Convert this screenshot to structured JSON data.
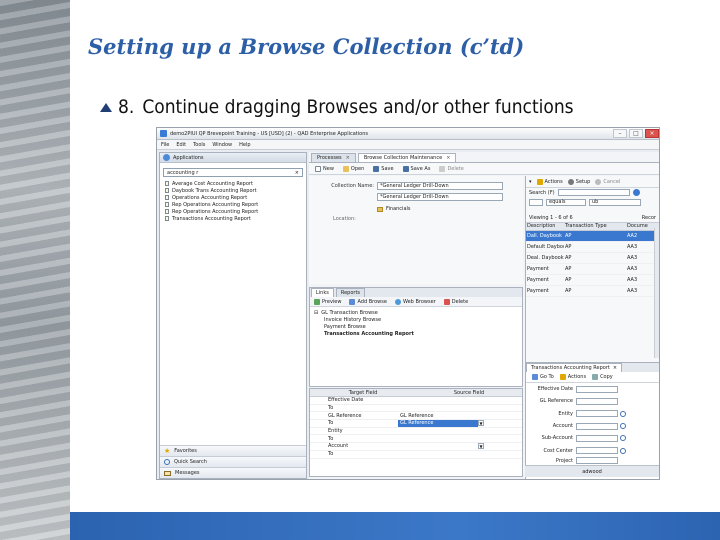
{
  "slide": {
    "title": "Setting up a Browse Collection (c’td)",
    "bullet_number": "8.",
    "bullet_text": "Continue dragging Browses and/or other functions"
  },
  "window": {
    "title": "demo2PIUI QP Brevepoint Training - US [USD] (2) - QAD Enterprise Applications",
    "menu": [
      "File",
      "Edit",
      "Tools",
      "Window",
      "Help"
    ]
  },
  "nav": {
    "header": "Applications",
    "search_value": "accounting r",
    "items": [
      "Average Cost Accounting Report",
      "Daybook Trans Accounting Report",
      "Operations Accounting Report",
      "Rep Operations Accounting Report",
      "Rep Operations Accounting Report",
      "Transactions Accounting Report"
    ],
    "bottom": [
      "Favorites",
      "Quick Search",
      "Messages"
    ]
  },
  "main": {
    "tabs": [
      {
        "label": "Processes",
        "active": false
      },
      {
        "label": "Browse Collection Maintenance",
        "active": true
      }
    ],
    "toolbar": [
      "New",
      "Open",
      "Save",
      "Save As",
      "Delete"
    ],
    "form": {
      "collection_label": "Collection Name:",
      "collection_value": "*General Ledger Drill-Down",
      "description_value": "*General Ledger Drill-Down",
      "location_label": "Location:",
      "location_value": "Financials"
    },
    "links_tabs": [
      {
        "label": "Links",
        "active": true
      },
      {
        "label": "Reports",
        "active": false
      }
    ],
    "links_toolbar": [
      "Preview",
      "Add Browse",
      "Web Browser",
      "Delete"
    ],
    "tree": [
      {
        "label": "GL Transaction Browse",
        "level": 1,
        "bold": false
      },
      {
        "label": "Invoice History Browse",
        "level": 2,
        "bold": false
      },
      {
        "label": "Payment Browse",
        "level": 2,
        "bold": false
      },
      {
        "label": "Transactions Accounting Report",
        "level": 2,
        "bold": true
      }
    ],
    "map_headers": [
      "Target Field",
      "Source Field"
    ],
    "map_rows": [
      {
        "target": "Effective Date",
        "source": "",
        "selected": false
      },
      {
        "target": "To",
        "source": "",
        "selected": false
      },
      {
        "target": "GL Reference",
        "source": "GL Reference",
        "selected": false
      },
      {
        "target": "To",
        "source": "GL Reference",
        "selected": true
      },
      {
        "target": "Entity",
        "source": "",
        "selected": false
      },
      {
        "target": "To",
        "source": "",
        "selected": false
      },
      {
        "target": "Account",
        "source": "",
        "selected": false
      },
      {
        "target": "To",
        "source": "",
        "selected": false
      }
    ]
  },
  "right": {
    "toolbar": [
      "Actions",
      "Setup",
      "Cancel"
    ],
    "search_label": "Search (F)",
    "filter_value": "equals",
    "filter_right": "ub",
    "viewing": "Viewing 1 - 6 of 6",
    "viewing_right": "Recor",
    "grid_headers": [
      "Description",
      "Transaction Type",
      "Docume"
    ],
    "grid_rows": [
      {
        "c1": "Dall. Daybook",
        "c2": "AP",
        "c3": "AA2",
        "selected": true
      },
      {
        "c1": "Default Daybook",
        "c2": "AP",
        "c3": "AA3",
        "selected": false
      },
      {
        "c1": "Deal. Daybook",
        "c2": "AP",
        "c3": "AA3",
        "selected": false
      },
      {
        "c1": "Payment",
        "c2": "AP",
        "c3": "AA3",
        "selected": false
      },
      {
        "c1": "Payment",
        "c2": "AP",
        "c3": "AA3",
        "selected": false
      },
      {
        "c1": "Payment",
        "c2": "AP",
        "c3": "AA3",
        "selected": false
      }
    ],
    "sub_tab": "Transactions Accounting Report",
    "sub_toolbar": [
      "Go To",
      "Actions",
      "Copy"
    ],
    "sub_fields": [
      "Effective Date",
      "GL Reference",
      "Entity",
      "Account",
      "Sub-Account",
      "Cost Center",
      "Project"
    ],
    "status": "adwood"
  },
  "colors": {
    "title_blue": "#2d5fa7",
    "selection": "#3a78d0",
    "bottom_band": "#3c78c8"
  }
}
